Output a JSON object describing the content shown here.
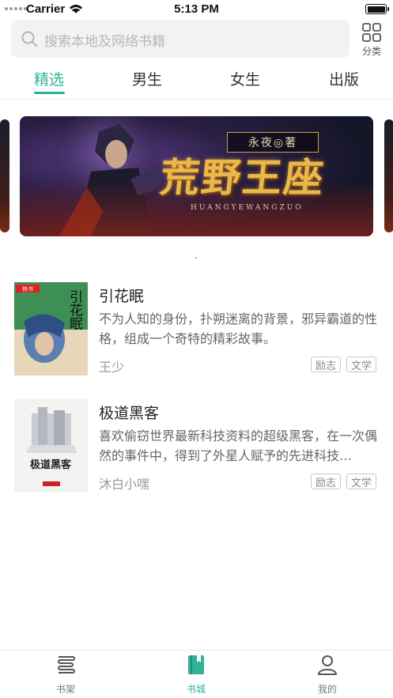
{
  "status_bar": {
    "carrier": "Carrier",
    "time": "5:13 PM"
  },
  "search": {
    "placeholder": "搜索本地及网络书籍"
  },
  "category": {
    "label": "分类",
    "icon": "grid-icon"
  },
  "tabs": [
    {
      "label": "精选",
      "active": true
    },
    {
      "label": "男生",
      "active": false
    },
    {
      "label": "女生",
      "active": false
    },
    {
      "label": "出版",
      "active": false
    }
  ],
  "banner": {
    "title": "荒野王座",
    "author_badge": "永夜◎著",
    "subtitle": "HUANGYEWANGZUO"
  },
  "books": [
    {
      "title": "引花眠",
      "description": "不为人知的身份，扑朔迷离的背景，邪异霸道的性格，组成一个奇特的精彩故事。",
      "author": "王少",
      "tags": [
        "励志",
        "文学"
      ],
      "cover_text": "引花眠"
    },
    {
      "title": "极道黑客",
      "description": "喜欢偷窃世界最新科技资料的超级黑客，在一次偶然的事件中，得到了外星人赋予的先进科技…",
      "author": "沐白小嘿",
      "tags": [
        "励志",
        "文学"
      ],
      "cover_text": "极道黑客"
    }
  ],
  "tabbar": [
    {
      "label": "书架",
      "icon": "bookshelf-icon",
      "active": false
    },
    {
      "label": "书城",
      "icon": "bookstore-icon",
      "active": true
    },
    {
      "label": "我的",
      "icon": "profile-icon",
      "active": false
    }
  ],
  "colors": {
    "accent": "#2fb396",
    "text": "#222222",
    "muted": "#999999"
  }
}
